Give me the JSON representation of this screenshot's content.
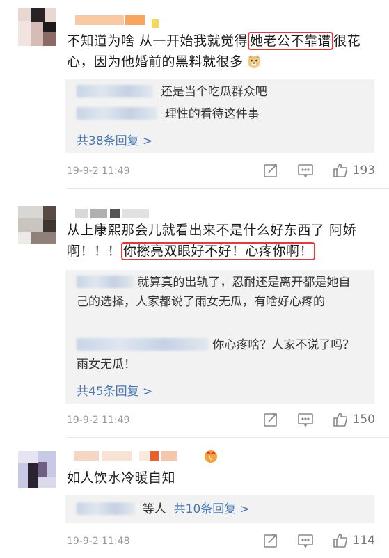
{
  "comments": [
    {
      "text_before": "不知道为啥 从一开始我就觉得",
      "highlight": "她老公不靠谱",
      "text_after": "很花心，因为他婚前的黑料就很多",
      "replies": [
        {
          "text": "还是当个吃瓜群众吧"
        },
        {
          "text": "理性的看待这件事"
        }
      ],
      "more_replies": "共38条回复 >",
      "time": "19-9-2 11:49",
      "likes": "193"
    },
    {
      "text_before": "从上康熙那会儿就看出来不是什么好东西了 阿娇啊！！！",
      "highlight": "你擦亮双眼好不好！心疼你啊！",
      "text_after": "",
      "replies": [
        {
          "text": "就算真的出轨了，忍耐还是离开都是她自己的选择，人家都说了雨女无瓜，有啥好心疼的"
        },
        {
          "text": "你心疼啥？人家不说了吗？雨女无瓜！"
        }
      ],
      "more_replies": "共45条回复 >",
      "time": "19-9-2 11:49",
      "likes": "150"
    },
    {
      "text_before": "如人饮水冷暖自知",
      "highlight": "",
      "text_after": "",
      "replies": [],
      "reply_prefix": "等人",
      "more_replies": "共10条回复 >",
      "time": "19-9-2 11:48",
      "likes": "114"
    }
  ],
  "icons": {
    "share": "share-icon",
    "comment": "comment-icon",
    "like": "thumbs-up-icon",
    "emoji_dog": "dog-emoji-icon",
    "vip_badge": "vip-badge-icon"
  },
  "colors": {
    "highlight_border": "#e0393e",
    "link": "#4a78b4",
    "meta": "#999999",
    "reply_bg": "#f2f2f2"
  }
}
